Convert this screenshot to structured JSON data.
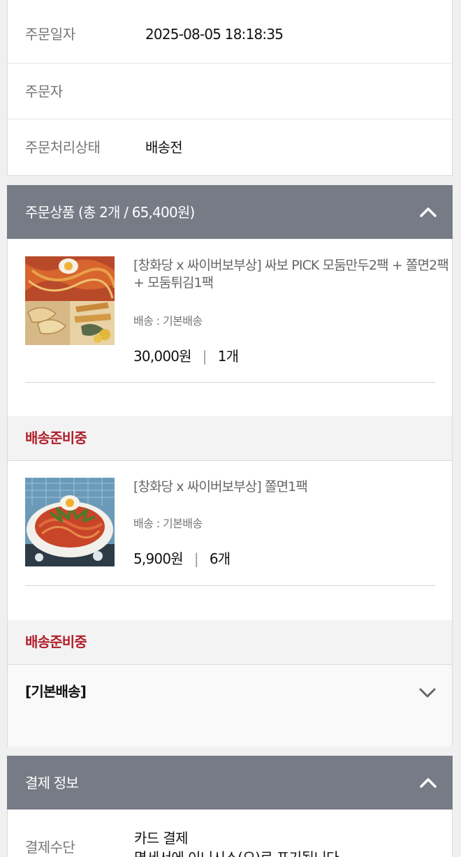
{
  "order_info": {
    "rows": [
      {
        "label": "주문일자",
        "value": "2025-08-05 18:18:35"
      },
      {
        "label": "주문자",
        "value": ""
      },
      {
        "label": "주문처리상태",
        "value": "배송전"
      }
    ]
  },
  "products_section": {
    "title": "주문상품 (총 2개 / 65,400원)",
    "items": [
      {
        "name": "[창화당 x 싸이버보부상] 싸보 PICK 모둠만두2팩 + 쫄면2팩 + 모둠튀김1팩",
        "shipping": "배송 : 기본배송",
        "price": "30,000원",
        "separator": "|",
        "qty": "1개",
        "status": "배송준비중",
        "image_icon": "product-photo-dumplings-noodles"
      },
      {
        "name": "[창화당 x 싸이버보부상] 쫄면1팩",
        "shipping": "배송 : 기본배송",
        "price": "5,900원",
        "separator": "|",
        "qty": "6개",
        "status": "배송준비중",
        "image_icon": "product-photo-jjolmyeon"
      }
    ],
    "shipping_group": "[기본배송]"
  },
  "payment_section": {
    "title": "결제 정보",
    "method_label": "결제수단",
    "method_value": "카드 결제",
    "method_note": "명세서에 이니시스(으)로 표기됩니다"
  },
  "colors": {
    "header_bg": "#777b86",
    "status_red": "#b01e2a"
  }
}
